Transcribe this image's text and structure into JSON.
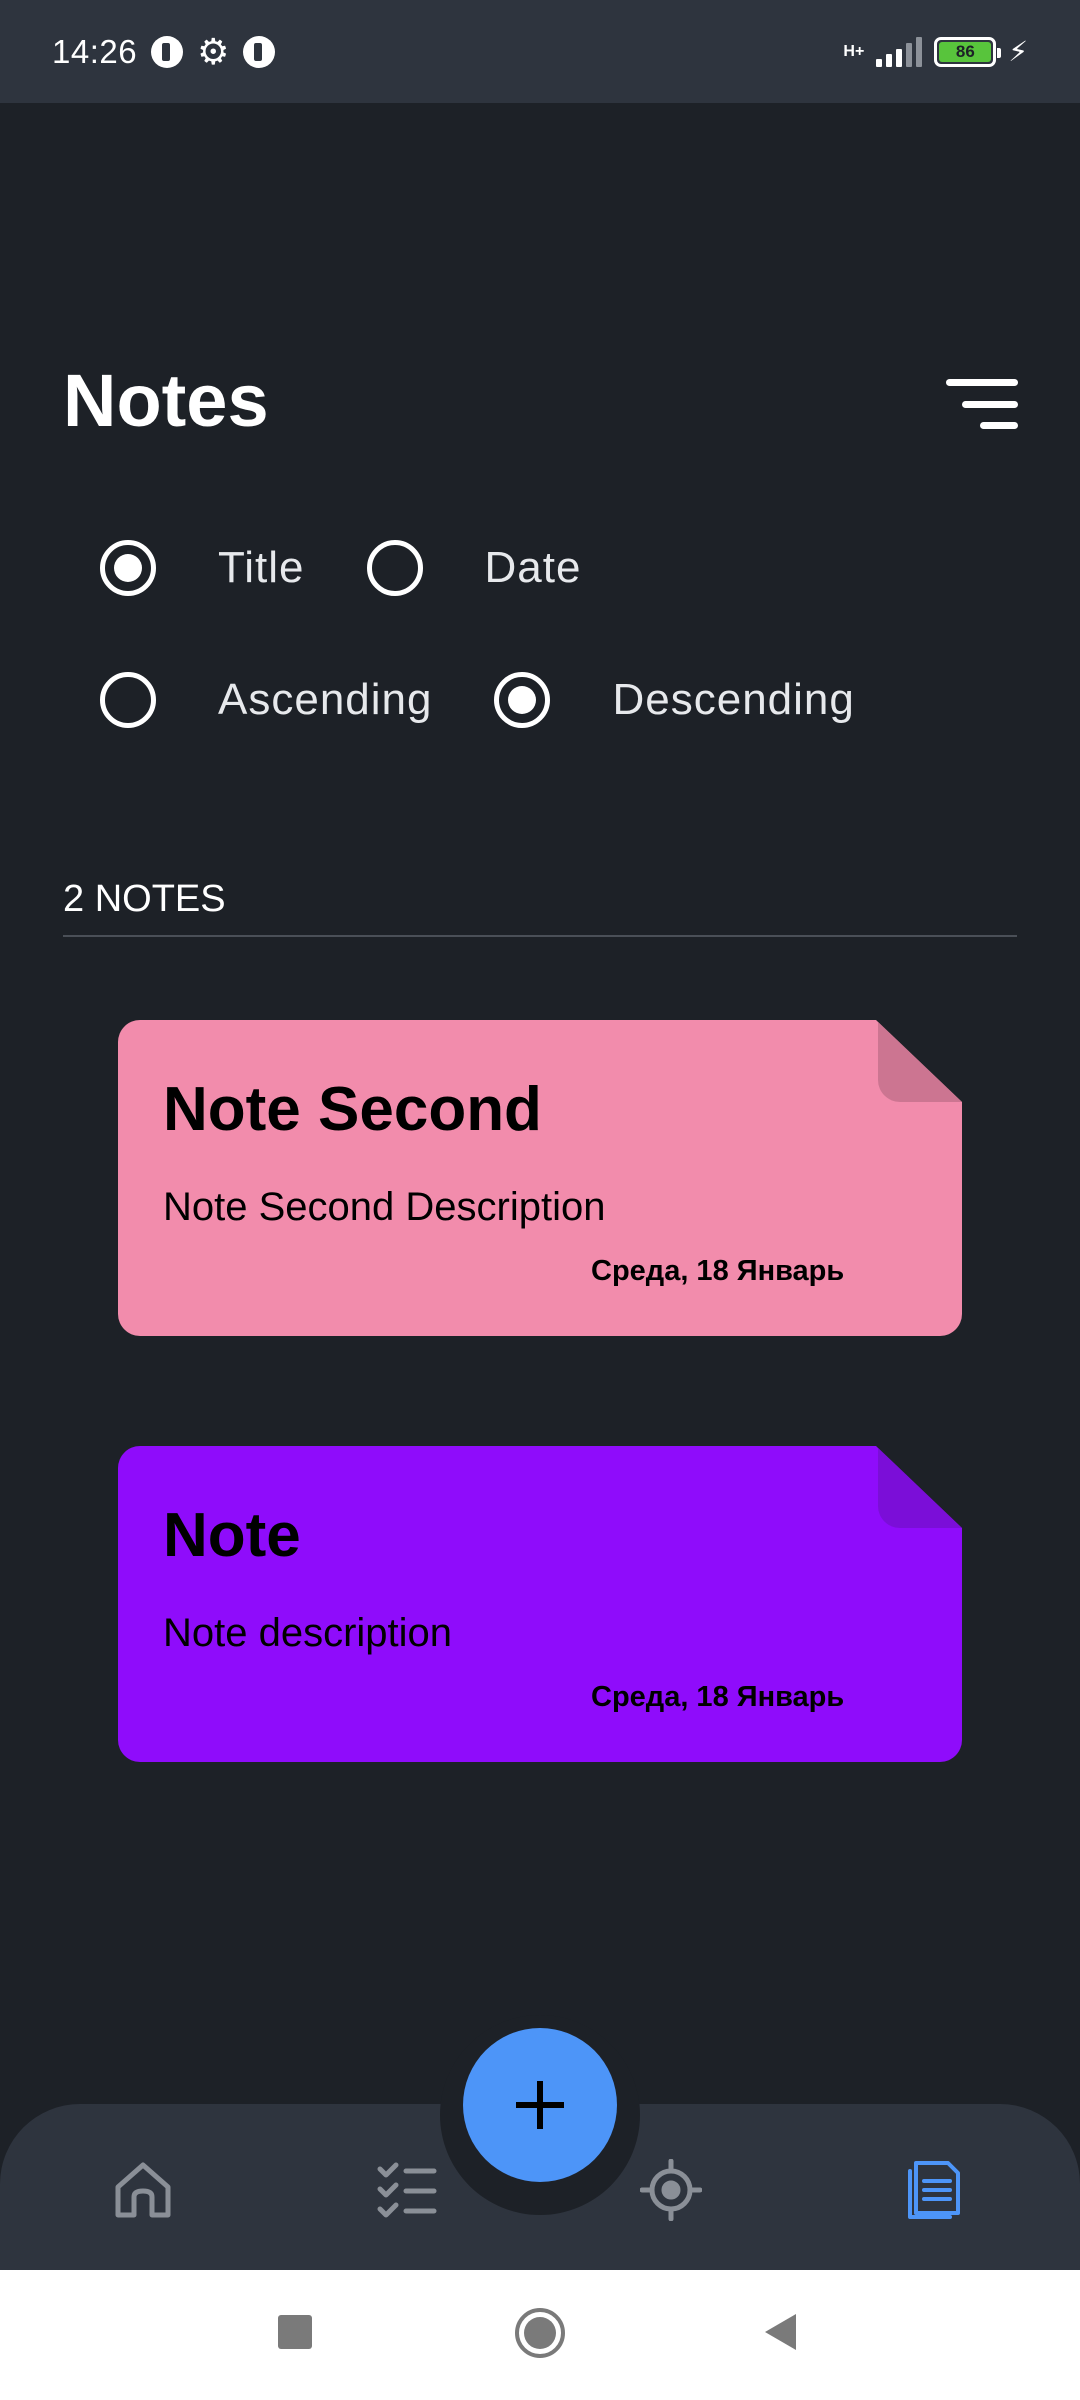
{
  "status_bar": {
    "time": "14:26",
    "network": "H+",
    "battery": "86"
  },
  "header": {
    "title": "Notes"
  },
  "sort": {
    "field_options": [
      {
        "label": "Title",
        "checked": true
      },
      {
        "label": "Date",
        "checked": false
      }
    ],
    "order_options": [
      {
        "label": "Ascending",
        "checked": false
      },
      {
        "label": "Descending",
        "checked": true
      }
    ]
  },
  "notes_count": "2 NOTES",
  "notes": [
    {
      "title": "Note Second",
      "description": "Note Second Description",
      "date": "Среда, 18 Январь",
      "color": "#f28cac",
      "fold_color": "#cc7591"
    },
    {
      "title": "Note",
      "description": "Note description",
      "date": "Среда, 18 Январь",
      "color": "#8f0cfb",
      "fold_color": "#7b0ed8"
    }
  ],
  "bottom_nav": {
    "items": [
      "home-icon",
      "checklist-icon",
      "crosshair-icon",
      "notes-icon"
    ],
    "active": "notes-icon",
    "fab_icon": "plus-icon",
    "accent": "#4d95f8",
    "inactive": "#8a8f97"
  },
  "system_nav": [
    "recents-icon",
    "home-circle-icon",
    "back-icon"
  ]
}
